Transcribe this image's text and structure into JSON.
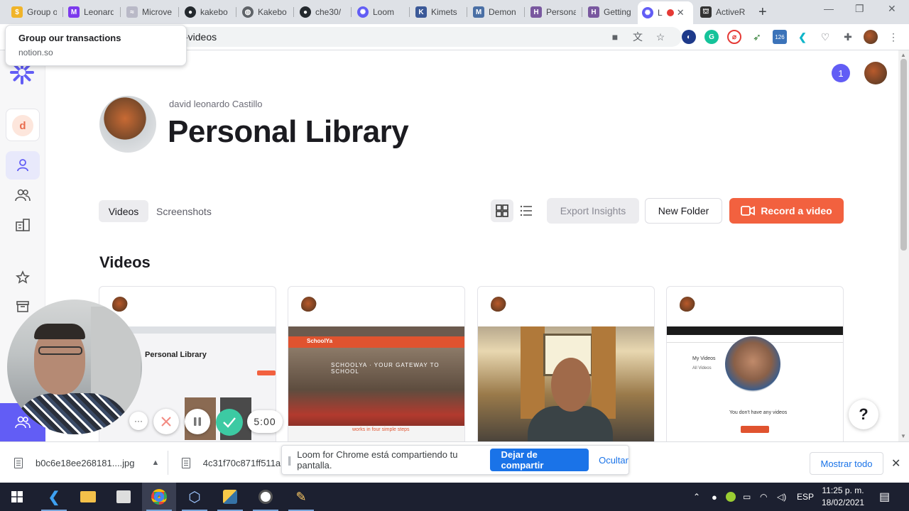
{
  "browser": {
    "tabs": [
      {
        "label": "Group o",
        "favicon": "notion-coin-icon",
        "color": "#f0b429",
        "glyph": "$"
      },
      {
        "label": "Leonard",
        "favicon": "loom-purple-icon",
        "color": "#7c3aed",
        "glyph": "M"
      },
      {
        "label": "Microve",
        "favicon": "wave-icon",
        "color": "#b9b9c7",
        "glyph": "≈"
      },
      {
        "label": "kakebo",
        "favicon": "github-icon",
        "color": "#24292e",
        "glyph": "●"
      },
      {
        "label": "Kakebo",
        "favicon": "globe-icon",
        "color": "#5f6368",
        "glyph": "◍"
      },
      {
        "label": "che30/",
        "favicon": "github-icon",
        "color": "#24292e",
        "glyph": "●"
      },
      {
        "label": "Loom",
        "favicon": "loom-icon",
        "color": "#625df5",
        "glyph": "✺"
      },
      {
        "label": "Kimets",
        "favicon": "kimetsu-icon",
        "color": "#3b5998",
        "glyph": "K"
      },
      {
        "label": "Demon",
        "favicon": "dm-icon",
        "color": "#4a6fa5",
        "glyph": "M"
      },
      {
        "label": "Persona",
        "favicon": "heroku-icon",
        "color": "#79589f",
        "glyph": "H"
      },
      {
        "label": "Getting",
        "favicon": "heroku-icon",
        "color": "#79589f",
        "glyph": "H"
      },
      {
        "label": "L",
        "favicon": "loom-icon",
        "color": "#625df5",
        "glyph": "✺"
      },
      {
        "label": "ActiveR",
        "favicon": "activerecord-icon",
        "color": "#333333",
        "glyph": "⛫"
      }
    ],
    "tooltip": {
      "title": "Group our transactions",
      "url": "notion.so"
    },
    "omnibox_text": "-videos",
    "extension_badge": "126"
  },
  "sidebar": {
    "workspace_initial": "d"
  },
  "header": {
    "notifications": "1",
    "owner_name": "david leonardo Castillo",
    "title": "Personal Library"
  },
  "toolbar": {
    "tab_videos": "Videos",
    "tab_screenshots": "Screenshots",
    "export_label": "Export Insights",
    "new_folder_label": "New Folder",
    "record_label": "Record a video"
  },
  "videos": {
    "section_title": "Videos",
    "card1": {
      "thumb_title": "Personal Library"
    },
    "card2": {
      "banner": "SchoolYa",
      "subtitle": "SCHOOLYA · YOUR GATEWAY TO SCHOOL",
      "footer": "works in four simple steps"
    },
    "card4": {
      "my_videos": "My Videos",
      "all_videos": "All Videos",
      "empty": "You don't have any videos"
    }
  },
  "help_label": "?",
  "recording": {
    "more": "···",
    "timer": "5:00"
  },
  "downloads": {
    "file1": "b0c6e18ee268181....jpg",
    "file2": "4c31f70c871ff511a...",
    "share_message": "Loom for Chrome está compartiendo tu pantalla.",
    "stop_share": "Dejar de compartir",
    "hide": "Ocultar",
    "show_all": "Mostrar todo"
  },
  "taskbar": {
    "language": "ESP",
    "time": "11:25 p. m.",
    "date": "18/02/2021"
  },
  "colors": {
    "loom_purple": "#625df5",
    "record_orange": "#f2613f",
    "confirm_green": "#3ccaa3",
    "chrome_blue": "#1a73e8"
  }
}
